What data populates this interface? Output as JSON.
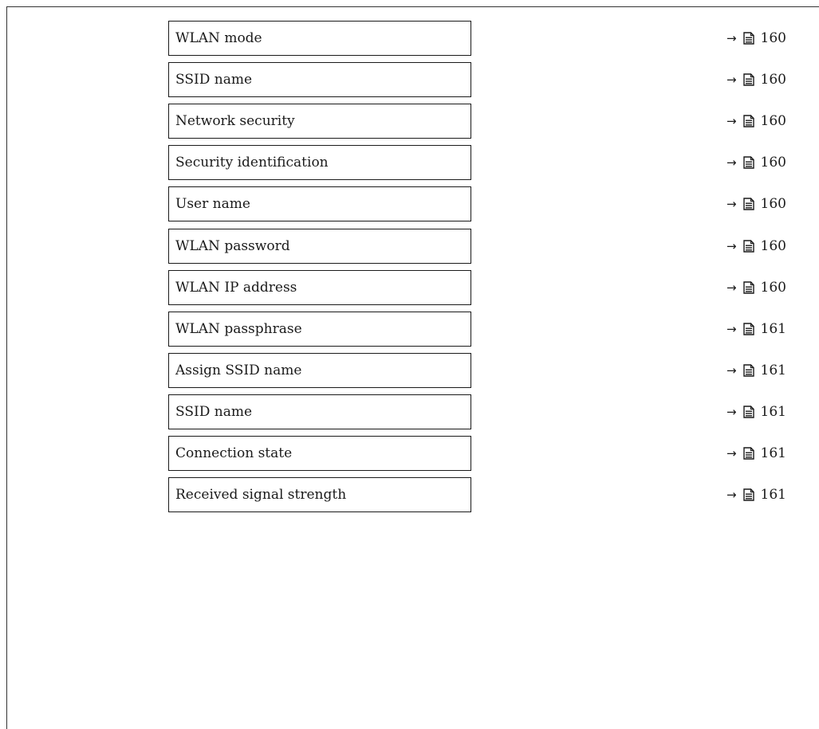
{
  "parameters": [
    {
      "label": "WLAN mode",
      "page": "160"
    },
    {
      "label": "SSID name",
      "page": "160"
    },
    {
      "label": "Network security",
      "page": "160"
    },
    {
      "label": "Security identification",
      "page": "160"
    },
    {
      "label": "User name",
      "page": "160"
    },
    {
      "label": "WLAN password",
      "page": "160"
    },
    {
      "label": "WLAN IP address",
      "page": "160"
    },
    {
      "label": "WLAN passphrase",
      "page": "161"
    },
    {
      "label": "Assign SSID name",
      "page": "161"
    },
    {
      "label": "SSID name",
      "page": "161"
    },
    {
      "label": "Connection state",
      "page": "161"
    },
    {
      "label": "Received signal strength",
      "page": "161"
    }
  ],
  "icons": {
    "reference_arrow": "arrow-right-icon",
    "reference_page": "page-reference-icon"
  },
  "reference_arrow_glyph": "→"
}
